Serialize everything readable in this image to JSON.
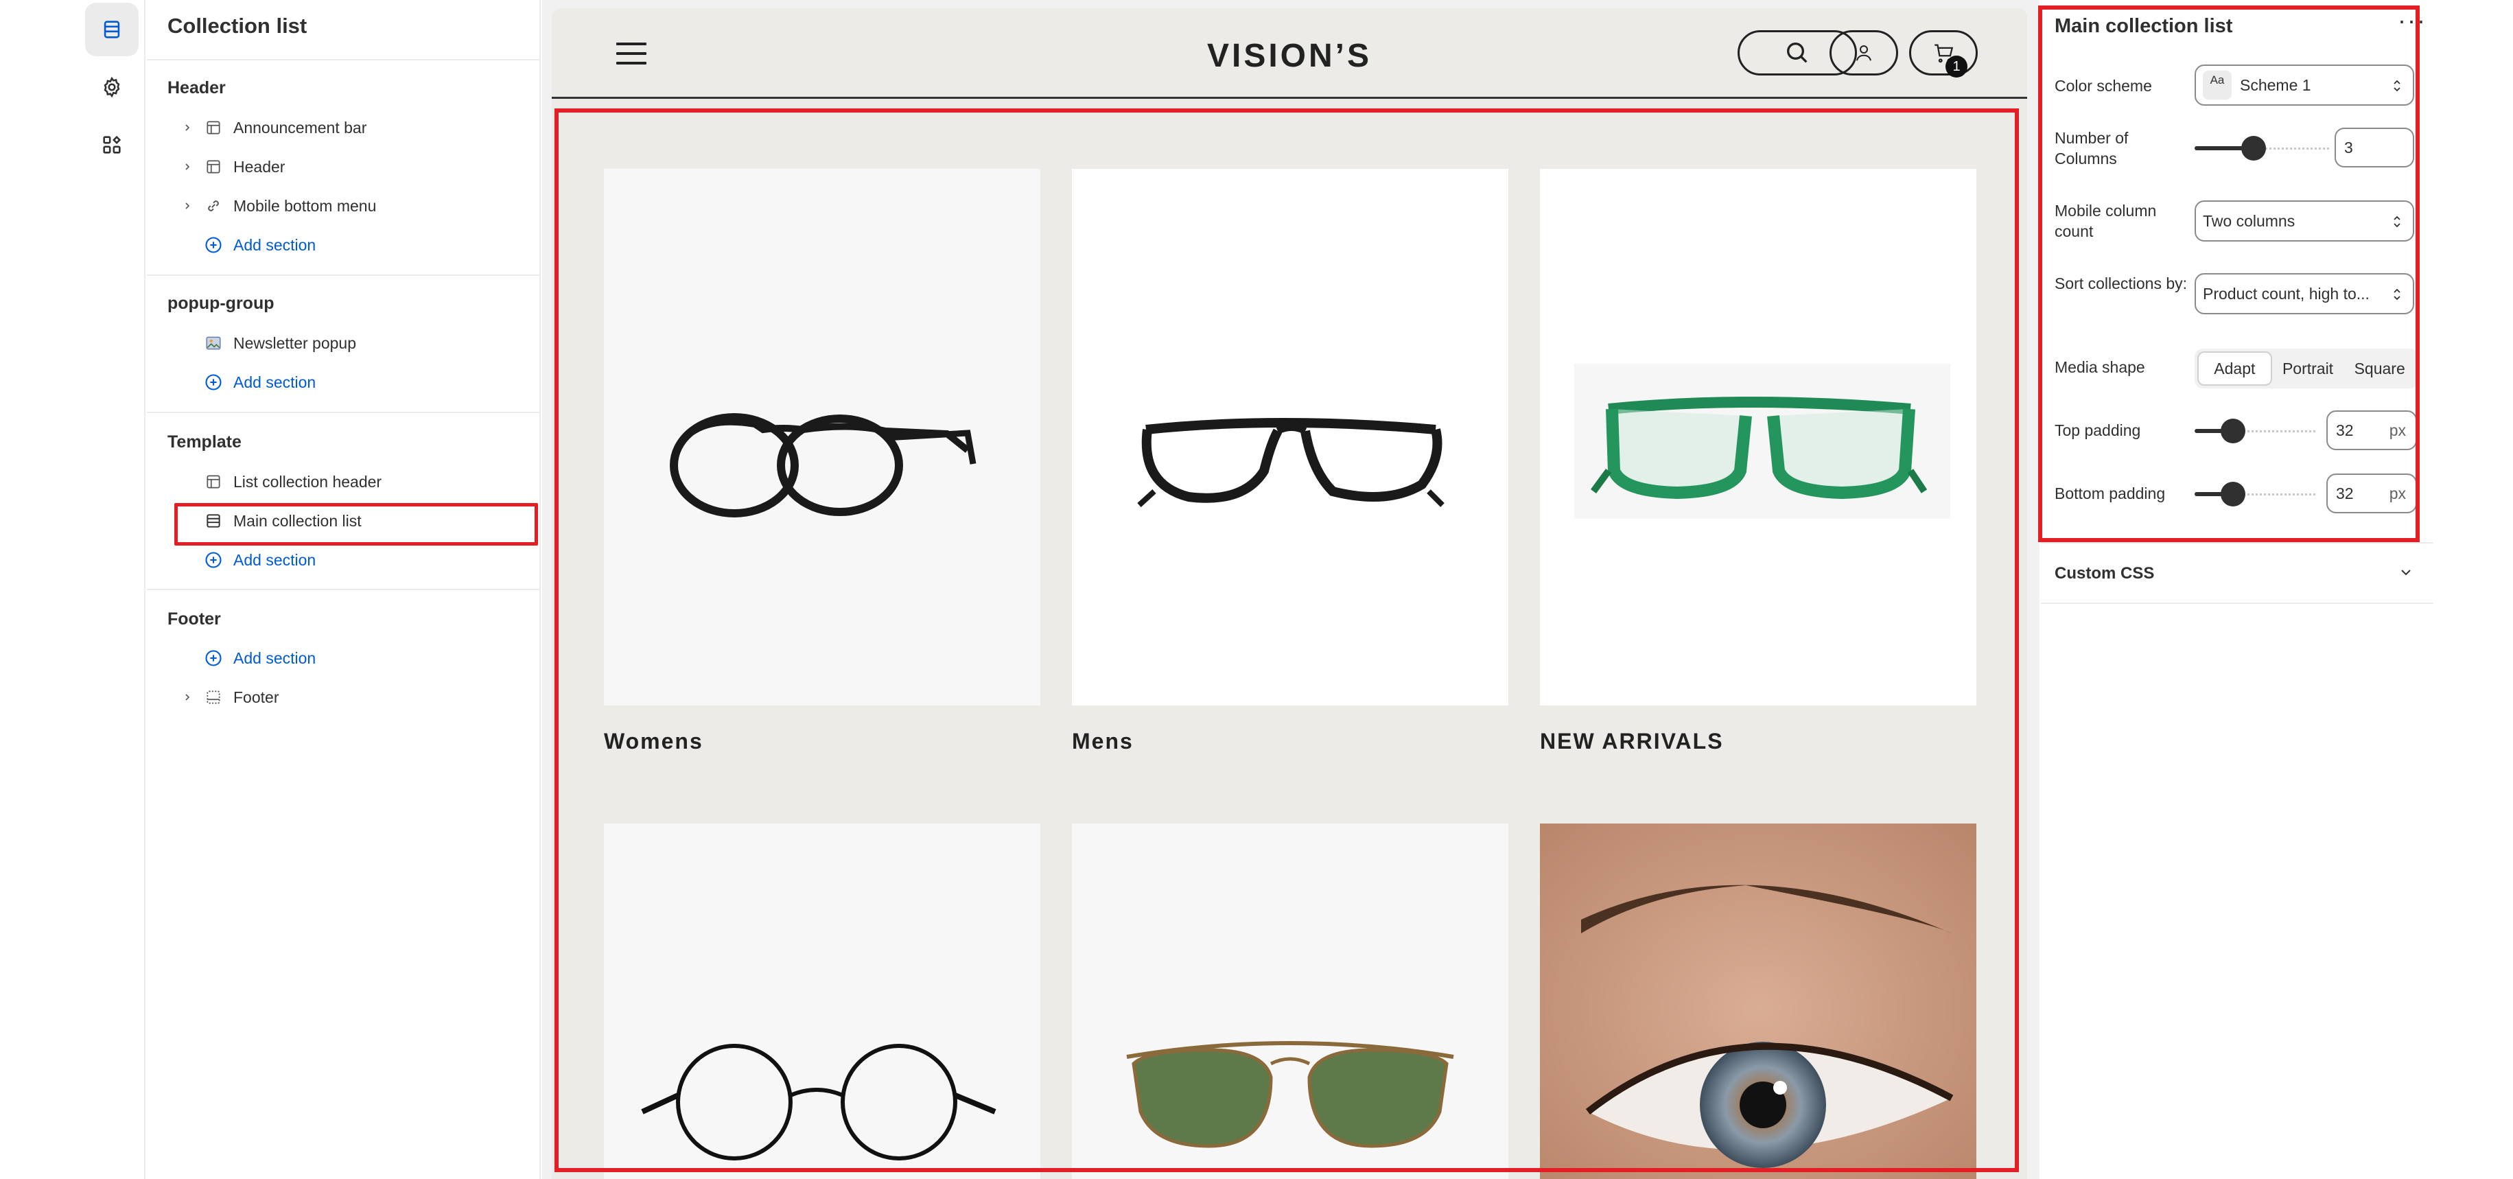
{
  "sidebar": {
    "title": "Collection list",
    "groups": [
      {
        "title": "Header",
        "items": [
          {
            "label": "Announcement bar"
          },
          {
            "label": "Header"
          },
          {
            "label": "Mobile bottom menu"
          }
        ],
        "add_label": "Add section"
      },
      {
        "title": "popup-group",
        "items": [
          {
            "label": "Newsletter popup"
          }
        ],
        "add_label": "Add section"
      },
      {
        "title": "Template",
        "items": [
          {
            "label": "List collection header"
          },
          {
            "label": "Main collection list"
          }
        ],
        "add_label": "Add section"
      },
      {
        "title": "Footer",
        "add_label": "Add section",
        "items": [
          {
            "label": "Footer"
          }
        ]
      }
    ]
  },
  "store": {
    "logo": "VISION’S",
    "cart_count": "1",
    "collections": [
      {
        "title": "Womens",
        "image": "black-round-glasses"
      },
      {
        "title": "Mens",
        "image": "black-rectangle-glasses"
      },
      {
        "title": "NEW ARRIVALS",
        "image": "green-glasses"
      },
      {
        "title": "",
        "image": "round-wire-glasses"
      },
      {
        "title": "",
        "image": "aviator-sunglasses"
      },
      {
        "title": "",
        "image": "eye-closeup"
      }
    ]
  },
  "settings": {
    "title": "Main collection list",
    "color_scheme_label": "Color scheme",
    "color_scheme_value": "Scheme 1",
    "swatch_text": "Aa",
    "columns_label": "Number of Columns",
    "columns_value": "3",
    "columns_fraction": 0.4,
    "mobile_label": "Mobile column count",
    "mobile_value": "Two columns",
    "sort_label": "Sort collections by:",
    "sort_value": "Product count, high to...",
    "media_label": "Media shape",
    "media_options": [
      "Adapt",
      "Portrait",
      "Square"
    ],
    "media_selected": "Adapt",
    "top_padding_label": "Top padding",
    "top_padding_value": "32",
    "bottom_padding_label": "Bottom padding",
    "bottom_padding_value": "32",
    "unit": "px",
    "custom_css_label": "Custom CSS"
  },
  "colors": {
    "highlight": "#e31e24",
    "link": "#005bd3",
    "store_bg": "#edebe8"
  }
}
